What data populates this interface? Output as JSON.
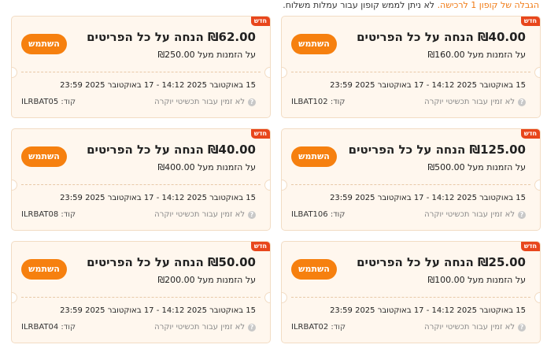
{
  "notice": {
    "part1": "הגבלה של קופון 1 לרכישה.",
    "part2": " לא ניתן לממש קופון עבור עמלות משלוח."
  },
  "labels": {
    "badge": "חדש",
    "use_button": "השתמש",
    "exclusion": "לא זמין עבור תכשיטי יוקרה",
    "code_label": "קוד:",
    "validity": "15 באוקטובר 2025 14:12 - 17 באוקטובר 2025 23:59"
  },
  "coupons": [
    {
      "amount": "₪40.00 הנחה על כל הפריטים",
      "min_order": "על הזמנות מעל ₪160.00",
      "code": "ILBAT102"
    },
    {
      "amount": "₪62.00 הנחה על כל הפריטים",
      "min_order": "על הזמנות מעל ₪250.00",
      "code": "ILRBAT05"
    },
    {
      "amount": "₪125.00 הנחה על כל הפריטים",
      "min_order": "על הזמנות מעל ₪500.00",
      "code": "ILBAT106"
    },
    {
      "amount": "₪40.00 הנחה על כל הפריטים",
      "min_order": "על הזמנות מעל ₪400.00",
      "code": "ILRBAT08"
    },
    {
      "amount": "₪25.00 הנחה על כל הפריטים",
      "min_order": "על הזמנות מעל ₪100.00",
      "code": "ILRBAT02"
    },
    {
      "amount": "₪50.00 הנחה על כל הפריטים",
      "min_order": "על הזמנות מעל ₪200.00",
      "code": "ILRBAT04"
    }
  ],
  "colors": {
    "accent_orange": "#f6800f",
    "badge_red": "#e8461c",
    "card_bg": "#fff7ee"
  }
}
